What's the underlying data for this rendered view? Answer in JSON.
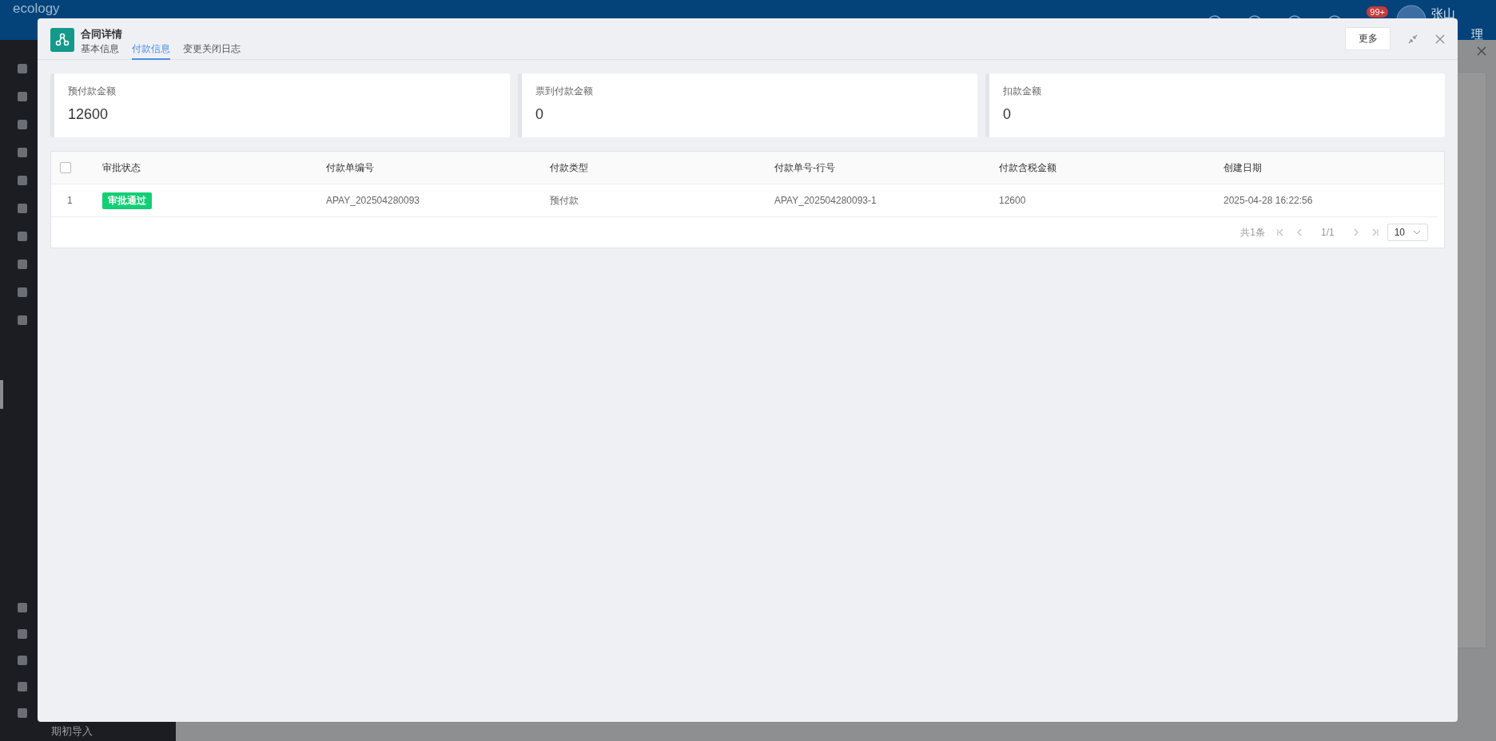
{
  "background": {
    "logo": "ecology",
    "notification_badge": "99+",
    "user_name": "张山",
    "header_text": "理",
    "sidebar_bottom_item": "期初导入"
  },
  "dialog": {
    "title": "合同详情",
    "tabs": [
      {
        "label": "基本信息",
        "selected": false
      },
      {
        "label": "付款信息",
        "selected": true
      },
      {
        "label": "变更关闭日志",
        "selected": false
      }
    ],
    "more_button": "更多",
    "summary_cards": [
      {
        "label": "预付款金额",
        "value": "12600"
      },
      {
        "label": "票到付款金额",
        "value": "0"
      },
      {
        "label": "扣款金额",
        "value": "0"
      }
    ],
    "table": {
      "select_all_checked": false,
      "columns": [
        "审批状态",
        "付款单编号",
        "付款类型",
        "付款单号-行号",
        "付款含税金额",
        "创建日期"
      ],
      "rows": [
        {
          "index": "1",
          "status": "审批通过",
          "payment_no": "APAY_202504280093",
          "payment_type": "预付款",
          "line_no": "APAY_202504280093-1",
          "amount": "12600",
          "created": "2025-04-28 16:22:56"
        }
      ]
    },
    "pagination": {
      "total": "共1条",
      "page": "1/1",
      "page_size": "10"
    }
  }
}
